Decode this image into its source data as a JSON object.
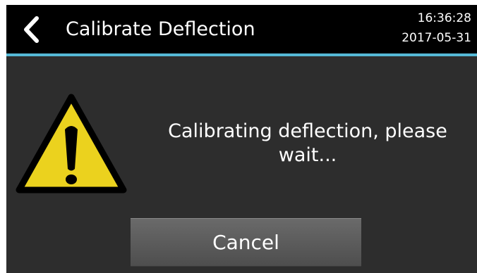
{
  "header": {
    "title": "Calibrate Deflection",
    "back_icon": "chevron-left-icon",
    "time": "16:36:28",
    "date": "2017-05-31"
  },
  "main": {
    "warning_icon": "warning-triangle-icon",
    "message": "Calibrating deflection, please wait...",
    "cancel_label": "Cancel"
  },
  "colors": {
    "header_background": "#000000",
    "accent_rule": "#55b9d6",
    "body_background": "#2d2d2d",
    "warning_fill": "#ebd21e",
    "text": "#ffffff"
  }
}
